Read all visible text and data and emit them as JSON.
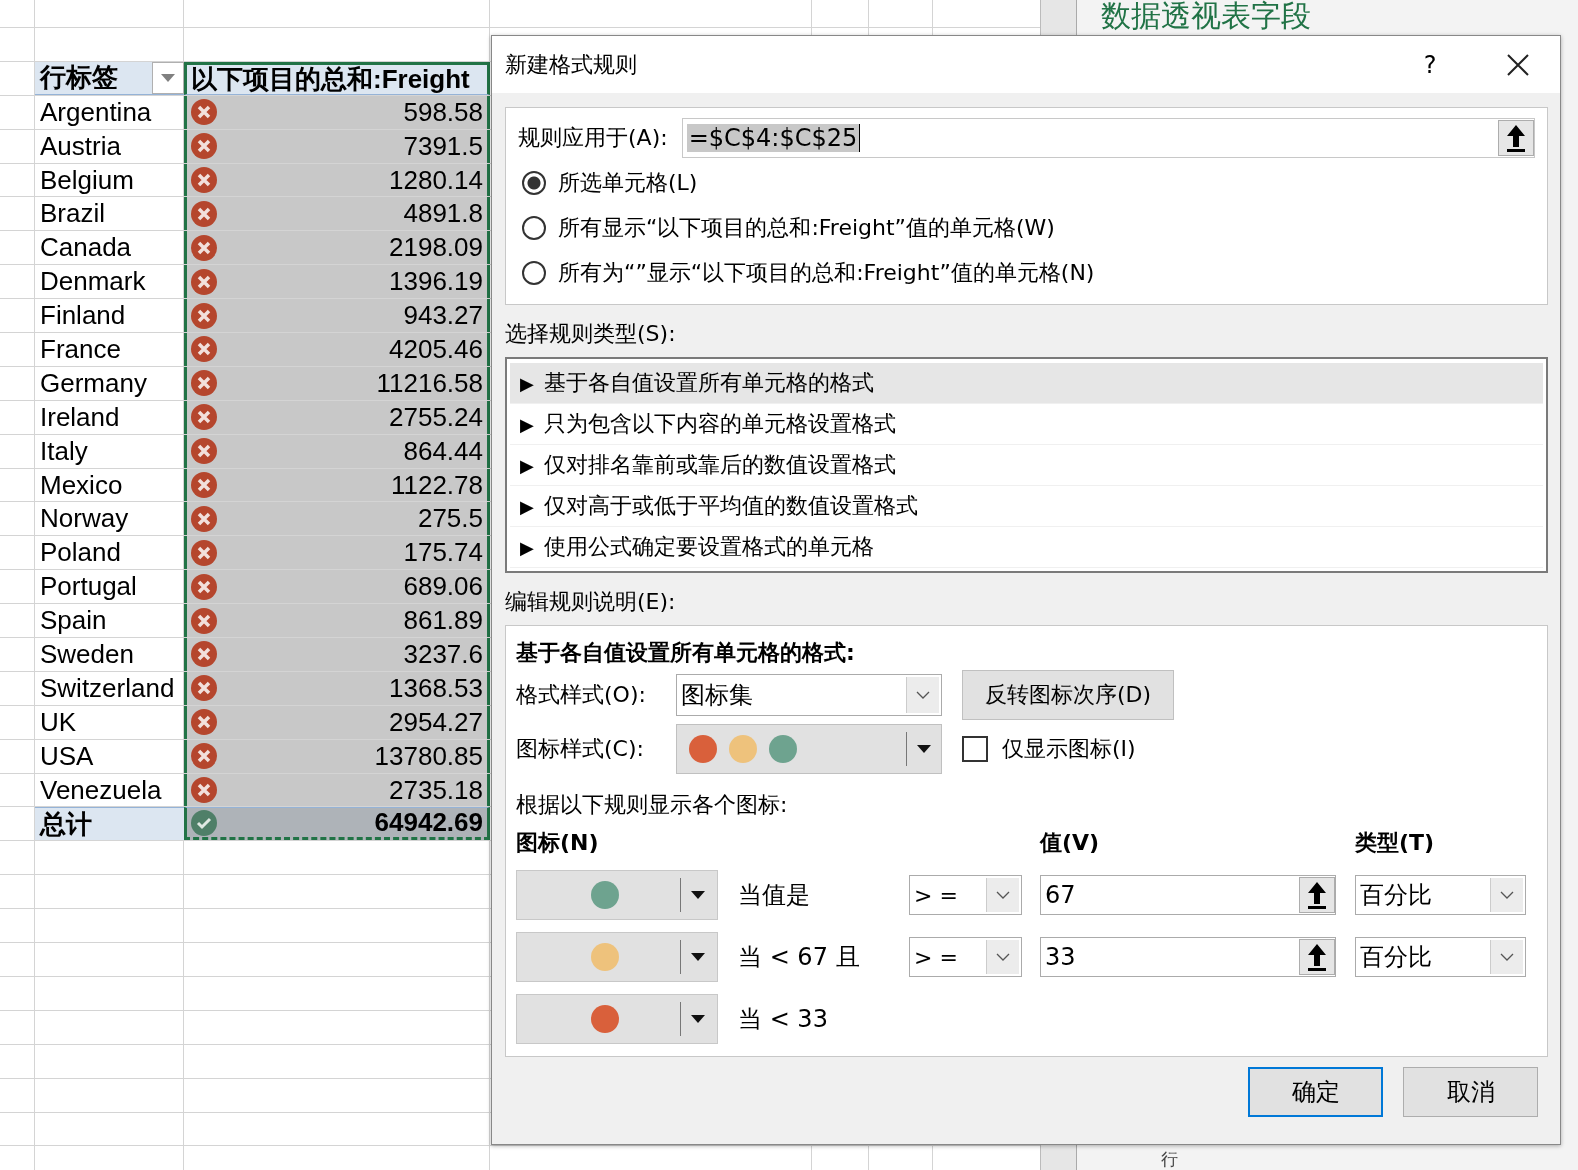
{
  "pivot_table": {
    "row_label_header": "行标签",
    "value_header": "以下项目的总和:Freight",
    "rows": [
      {
        "label": "Argentina",
        "value": "598.58",
        "kind": "cross"
      },
      {
        "label": "Austria",
        "value": "7391.5",
        "kind": "cross"
      },
      {
        "label": "Belgium",
        "value": "1280.14",
        "kind": "cross"
      },
      {
        "label": "Brazil",
        "value": "4891.8",
        "kind": "cross"
      },
      {
        "label": "Canada",
        "value": "2198.09",
        "kind": "cross"
      },
      {
        "label": "Denmark",
        "value": "1396.19",
        "kind": "cross"
      },
      {
        "label": "Finland",
        "value": "943.27",
        "kind": "cross"
      },
      {
        "label": "France",
        "value": "4205.46",
        "kind": "cross"
      },
      {
        "label": "Germany",
        "value": "11216.58",
        "kind": "cross"
      },
      {
        "label": "Ireland",
        "value": "2755.24",
        "kind": "cross"
      },
      {
        "label": "Italy",
        "value": "864.44",
        "kind": "cross"
      },
      {
        "label": "Mexico",
        "value": "1122.78",
        "kind": "cross"
      },
      {
        "label": "Norway",
        "value": "275.5",
        "kind": "cross"
      },
      {
        "label": "Poland",
        "value": "175.74",
        "kind": "cross"
      },
      {
        "label": "Portugal",
        "value": "689.06",
        "kind": "cross"
      },
      {
        "label": "Spain",
        "value": "861.89",
        "kind": "cross"
      },
      {
        "label": "Sweden",
        "value": "3237.6",
        "kind": "cross"
      },
      {
        "label": "Switzerland",
        "value": "1368.53",
        "kind": "cross"
      },
      {
        "label": "UK",
        "value": "2954.27",
        "kind": "cross"
      },
      {
        "label": "USA",
        "value": "13780.85",
        "kind": "cross"
      },
      {
        "label": "Venezuela",
        "value": "2735.18",
        "kind": "cross"
      }
    ],
    "total": {
      "label": "总计",
      "value": "64942.69",
      "kind": "check"
    }
  },
  "side_panel": {
    "title": "数据透视表字段",
    "area_label": "行"
  },
  "dialog": {
    "title": "新建格式规则",
    "help": "?",
    "apply_to": {
      "label": "规则应用于(A):",
      "value": "=$C$4:$C$25"
    },
    "scope_options": [
      {
        "label": "所选单元格(L)",
        "selected": true
      },
      {
        "label": "所有显示“以下项目的总和:Freight”值的单元格(W)",
        "selected": false
      },
      {
        "label": "所有为“”显示“以下项目的总和:Freight”值的单元格(N)",
        "selected": false
      }
    ],
    "rule_type_label": "选择规则类型(S):",
    "rule_types": [
      {
        "arrow": "▶",
        "label": "基于各自值设置所有单元格的格式",
        "selected": true
      },
      {
        "arrow": "▶",
        "label": "只为包含以下内容的单元格设置格式",
        "selected": false
      },
      {
        "arrow": "▶",
        "label": "仅对排名靠前或靠后的数值设置格式",
        "selected": false
      },
      {
        "arrow": "▶",
        "label": "仅对高于或低于平均值的数值设置格式",
        "selected": false
      },
      {
        "arrow": "▶",
        "label": "使用公式确定要设置格式的单元格",
        "selected": false
      }
    ],
    "edit_label": "编辑规则说明(E):",
    "description_heading": "基于各自值设置所有单元格的格式:",
    "format_style": {
      "label": "格式样式(O):",
      "value": "图标集"
    },
    "reverse_button": "反转图标次序(D)",
    "icon_style": {
      "label": "图标样式(C):",
      "icons": [
        {
          "color": "#d9603b"
        },
        {
          "color": "#eec27c"
        },
        {
          "color": "#6ea38f"
        }
      ]
    },
    "show_icon_only": {
      "label": "仅显示图标(I)",
      "checked": false
    },
    "rules_heading": "根据以下规则显示各个图标:",
    "columns": {
      "icon": "图标(N)",
      "value": "值(V)",
      "type": "类型(T)"
    },
    "icon_rules": [
      {
        "color": "#6ea38f",
        "condition": "当值是",
        "operator": "> =",
        "value": "67",
        "type": "百分比"
      },
      {
        "color": "#eec27c",
        "condition": "当 < 67 且",
        "operator": "> =",
        "value": "33",
        "type": "百分比"
      },
      {
        "color": "#d9603b",
        "condition": "当 < 33"
      }
    ],
    "buttons": [
      {
        "label": "确定",
        "default": true
      },
      {
        "label": "取消",
        "default": false
      }
    ]
  }
}
